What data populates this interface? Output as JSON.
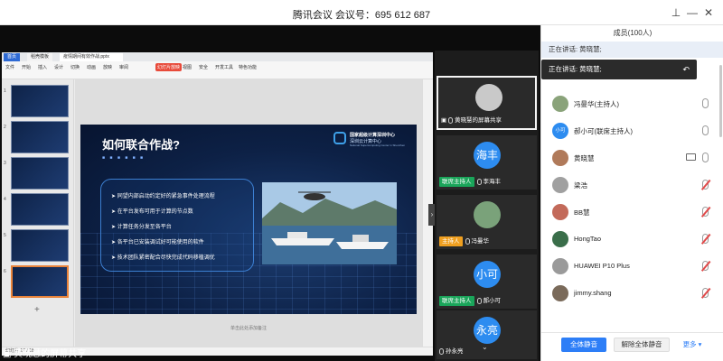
{
  "window": {
    "title": "腾讯会议 会议号：695 612 687"
  },
  "ppt": {
    "tabs": [
      "首页",
      "稻壳模板",
      "疫情期间有效作战.pptx"
    ],
    "menus": [
      "文件",
      "开始",
      "插入",
      "设计",
      "切换",
      "动画",
      "放映",
      "审阅",
      "视图",
      "安全",
      "开发工具",
      "特色功能"
    ],
    "active_menu": "幻灯片放映",
    "thumb_numbers": [
      "1",
      "2",
      "3",
      "4",
      "5",
      "6"
    ],
    "status": "幻灯片 17 / 18",
    "note_hint": "单击此处添加备注"
  },
  "slide": {
    "title": "如何联合作战?",
    "org_line1": "国家超级计算深圳中心",
    "org_line2": "深圳云计算中心",
    "org_line3": "National Supercomputing Center in Shenzhen",
    "bullets": [
      "同望内部启动约定好的紧急事件处理流程",
      "在平台发布可用于计算的节点数",
      "计算任务分发至各平台",
      "各平台已安装调试好可能使用的软件",
      "技术团队紧密配合尽快完成代码移植调优"
    ]
  },
  "participants": [
    {
      "name": "黄晓慧的屏幕共享",
      "tag": "",
      "avatar_text": "",
      "active": true
    },
    {
      "name": "李海丰",
      "tag": "联席主持人",
      "tag_color": "#1aa55a",
      "avatar_text": "海丰",
      "avatar_color": "#2d8cf0"
    },
    {
      "name": "冯曼华",
      "tag": "主持人",
      "tag_color": "#f0a020",
      "avatar_text": "",
      "avatar_color": "#7aa27a"
    },
    {
      "name": "郝小可",
      "tag": "联席主持人",
      "tag_color": "#1aa55a",
      "avatar_text": "小可",
      "avatar_color": "#2d8cf0"
    },
    {
      "name": "孙永亮",
      "tag": "",
      "avatar_text": "永亮",
      "avatar_color": "#2d8cf0"
    }
  ],
  "share_label": "黄晓慧的屏幕共享",
  "panel": {
    "header": "成员(100人)",
    "speaking": "正在讲话: 黄晓慧;",
    "tooltip": "正在讲话: 黄晓慧;",
    "members": [
      {
        "name": "冯曼华(主持人)",
        "avatar_text": "",
        "avatar_color": "#8aa37a",
        "muted": false,
        "sharing": false
      },
      {
        "name": "郝小可(联席主持人)",
        "avatar_text": "小可",
        "avatar_color": "#2d8cf0",
        "muted": false,
        "sharing": false
      },
      {
        "name": "黄晓慧",
        "avatar_text": "",
        "avatar_color": "#b07a5a",
        "muted": false,
        "sharing": true
      },
      {
        "name": "梁浩",
        "avatar_text": "",
        "avatar_color": "#a0a0a0",
        "muted": true,
        "sharing": false
      },
      {
        "name": "BB慧",
        "avatar_text": "",
        "avatar_color": "#c36a5a",
        "muted": true,
        "sharing": false
      },
      {
        "name": "HongTao",
        "avatar_text": "",
        "avatar_color": "#3a6e4a",
        "muted": true,
        "sharing": false
      },
      {
        "name": "HUAWEI P10 Plus",
        "avatar_text": "",
        "avatar_color": "#9a9a9a",
        "muted": true,
        "sharing": false
      },
      {
        "name": "jimmy.shang",
        "avatar_text": "",
        "avatar_color": "#7a6a5a",
        "muted": true,
        "sharing": false
      }
    ],
    "btn_mute_all": "全体静音",
    "btn_unmute_all": "解除全体静音",
    "btn_more": "更多"
  }
}
